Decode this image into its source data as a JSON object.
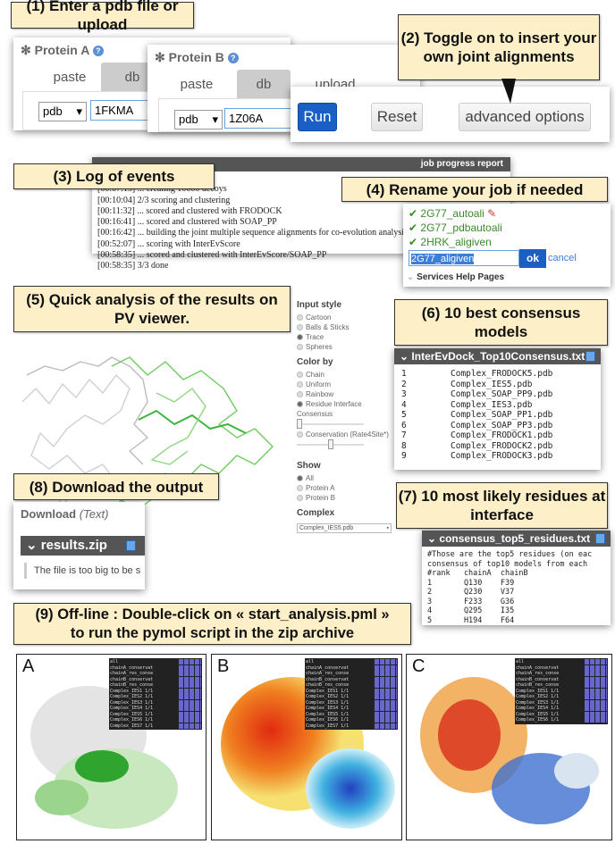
{
  "callouts": {
    "c1": "(1) Enter a pdb file or upload",
    "c2": "(2) Toggle on to insert your own joint alignments",
    "c3": "(3) Log of events",
    "c4": "(4) Rename your job if needed",
    "c5": "(5) Quick analysis of the results on PV viewer.",
    "c6": "(6) 10 best consensus models",
    "c7": "(7) 10 most likely residues at interface",
    "c8": "(8) Download the output",
    "c9a": "(9) Off-line : Double-click on « start_analysis.pml »",
    "c9b": "to run the pymol script in the zip archive"
  },
  "proteinA": {
    "title": "Protein A",
    "tabs": [
      "paste",
      "db"
    ],
    "db_select": "pdb",
    "value": "1FKMA"
  },
  "proteinB": {
    "title": "Protein B",
    "tabs": [
      "paste",
      "db",
      "upload"
    ],
    "db_select": "pdb",
    "value": "1Z06A"
  },
  "actions": {
    "run": "Run",
    "reset": "Reset",
    "advanced": "advanced options"
  },
  "log": {
    "title": "job progress report",
    "lines": [
      "[00:0?:??] ... computing scores",
      "[00:07:13] ... creating 10000 decoys",
      "[00:10:04] 2/3 scoring and clustering",
      "[00:11:32] ... scored and clustered with FRODOCK",
      "[00:16:41] ... scored and clustered with SOAP_PP",
      "[00:16:42] ... building the joint multiple sequence alignments for co-evolution analysis",
      "[00:52:07] ... scoring with InterEvScore",
      "[00:58:35] ... scored and clustered with InterEvScore/SOAP_PP",
      "[00:58:35] 3/3 done"
    ]
  },
  "jobs": {
    "items": [
      "2G77_autoali",
      "2G77_pdbautoali",
      "2HRK_aligiven"
    ],
    "rename_value": "2G77_aligiven",
    "ok": "ok",
    "cancel": "cancel",
    "help": "Services Help Pages"
  },
  "viewer": {
    "input_style": {
      "label": "Input style",
      "options": [
        "Cartoon",
        "Balls & Sticks",
        "Trace",
        "Spheres"
      ],
      "selected": "Trace"
    },
    "color_by": {
      "label": "Color by",
      "options": [
        "Chain",
        "Uniform",
        "Rainbow",
        "Residue Interface"
      ],
      "selected": "Residue Interface"
    },
    "consensus_label": "Consensus",
    "consensus_value": 0,
    "conservation_label": "Conservation (Rate4Site*)",
    "conservation_value": 0.5,
    "show": {
      "label": "Show",
      "options": [
        "All",
        "Protein A",
        "Protein B"
      ],
      "selected": "All"
    },
    "complex": {
      "label": "Complex",
      "value": "Complex_IES5.pdb"
    },
    "colors": {
      "protein_a": "#e8e8e8",
      "protein_b": "#7ccf6e"
    }
  },
  "consensus_file": {
    "name": "InterEvDock_Top10Consensus.txt",
    "rows": [
      [
        "1",
        "Complex_FRODOCK5.pdb"
      ],
      [
        "2",
        "Complex_IES5.pdb"
      ],
      [
        "3",
        "Complex_SOAP_PP9.pdb"
      ],
      [
        "4",
        "Complex_IES3.pdb"
      ],
      [
        "5",
        "Complex_SOAP_PP1.pdb"
      ],
      [
        "6",
        "Complex_SOAP_PP3.pdb"
      ],
      [
        "7",
        "Complex_FRODOCK1.pdb"
      ],
      [
        "8",
        "Complex_FRODOCK2.pdb"
      ],
      [
        "9",
        "Complex_FRODOCK3.pdb"
      ]
    ]
  },
  "residues_file": {
    "name": "consensus_top5_residues.txt",
    "lines": [
      "#Those are the top5 residues (on eac",
      "consensus of top10 models from each",
      "#rank   chainA  chainB",
      "1       Q130    F39",
      "2       Q230    V37",
      "3       F233    G36",
      "4       Q295    I35",
      "5       H194    F64"
    ]
  },
  "download": {
    "title": "Download",
    "subtitle": "(Text)",
    "file": "results.zip",
    "message": "The file is too big to be s"
  },
  "pymol": {
    "panels": [
      "A",
      "B",
      "C"
    ],
    "objects": [
      "all",
      "chainA_conservat",
      "chainA_res_conse",
      "chainB_conservat",
      "chainB_res_conse",
      "Complex_IES1 1/1",
      "Complex_IES2 1/1",
      "Complex_IES3 1/1",
      "Complex_IES4 1/1",
      "Complex_IES5 1/1",
      "Complex_IES6 1/1",
      "Complex_IES7 1/1"
    ]
  }
}
